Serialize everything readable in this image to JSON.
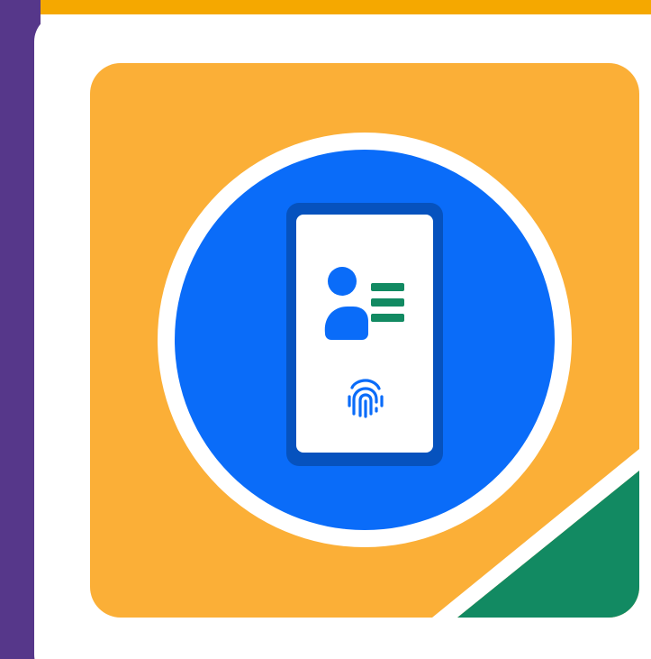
{
  "colors": {
    "top_band": "#F5A800",
    "left_band": "#56378A",
    "card": "#FFFFFF",
    "tile": "#FBAF37",
    "corner": "#128A62",
    "circle": "#0A6CF9",
    "circle_ring": "#FFFFFF",
    "phone_frame": "#0652BE",
    "phone_screen": "#FFFFFF",
    "person": "#0A6CF9",
    "list_lines": "#128A62",
    "fingerprint": "#0A6CF9"
  },
  "icons": {
    "phone": "smartphone-icon",
    "person": "user-profile-icon",
    "list": "list-lines-icon",
    "fingerprint": "fingerprint-icon"
  }
}
